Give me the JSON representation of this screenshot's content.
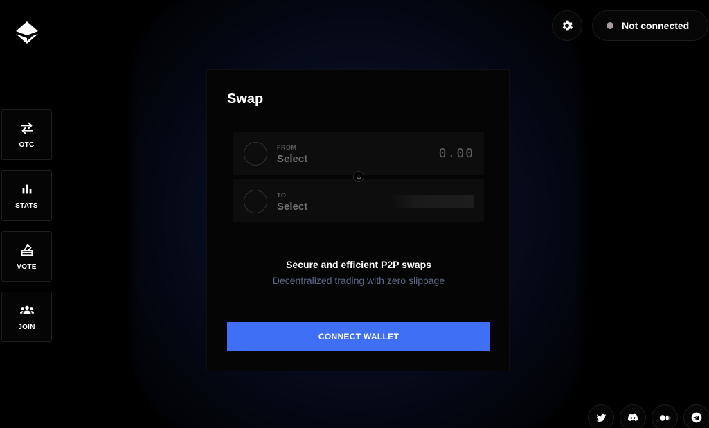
{
  "sidebar": {
    "items": [
      {
        "label": "OTC",
        "icon": "arrows-exchange-icon"
      },
      {
        "label": "STATS",
        "icon": "bar-chart-icon"
      },
      {
        "label": "VOTE",
        "icon": "ballot-box-icon"
      },
      {
        "label": "JOIN",
        "icon": "users-group-icon"
      }
    ]
  },
  "header": {
    "settings_icon": "gear-icon",
    "connection_status": "Not connected",
    "connection_dot_color": "#a79aa0"
  },
  "swap": {
    "title": "Swap",
    "from": {
      "direction": "FROM",
      "token": "Select",
      "amount_placeholder": "0.00"
    },
    "to": {
      "direction": "TO",
      "token": "Select"
    },
    "tagline": "Secure and efficient P2P swaps",
    "subtagline": "Decentralized trading with zero slippage",
    "connect_label": "CONNECT WALLET",
    "accent_color": "#3f6ff5"
  },
  "social": [
    {
      "name": "twitter-icon"
    },
    {
      "name": "discord-icon"
    },
    {
      "name": "medium-icon"
    },
    {
      "name": "telegram-icon"
    }
  ]
}
